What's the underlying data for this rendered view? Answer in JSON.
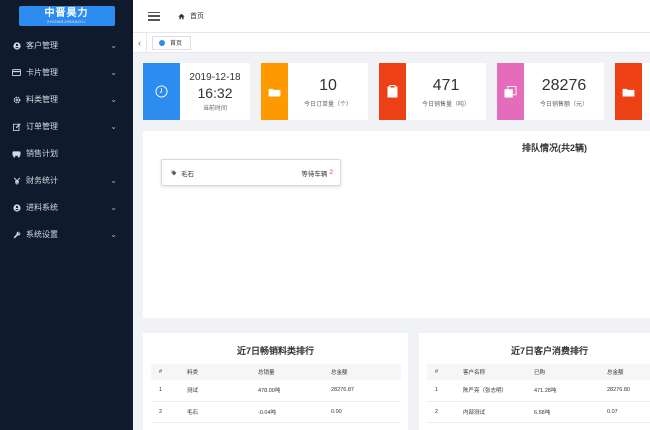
{
  "brand": {
    "name": "中晋昊力",
    "sub": "ZHONGJINHAOLI"
  },
  "sidebar": {
    "items": [
      {
        "label": "客户管理",
        "icon": "user-icon"
      },
      {
        "label": "卡片管理",
        "icon": "card-icon"
      },
      {
        "label": "料类管理",
        "icon": "gear-icon"
      },
      {
        "label": "订单管理",
        "icon": "edit-icon"
      },
      {
        "label": "销售计划",
        "icon": "truck-icon"
      },
      {
        "label": "财务统计",
        "icon": "yen-icon"
      },
      {
        "label": "进料系统",
        "icon": "user-icon"
      },
      {
        "label": "系统设置",
        "icon": "wrench-icon"
      }
    ]
  },
  "header": {
    "breadcrumb": "首页"
  },
  "tabs": [
    {
      "label": "首页"
    }
  ],
  "stats": {
    "date": {
      "date": "2019-12-18",
      "time": "16:32",
      "label": "当前时间",
      "color": "#2d8cf0"
    },
    "cards": [
      {
        "value": "10",
        "label": "今日订单量（个）",
        "color": "#ff9900"
      },
      {
        "value": "471",
        "label": "今日销售量（吨）",
        "color": "#ed4014"
      },
      {
        "value": "28276",
        "label": "今日销售额（元）",
        "color": "#e46cbb"
      },
      {
        "color": "#ed4014"
      }
    ]
  },
  "queue": {
    "title": "排队情况(共2辆)",
    "items": [
      {
        "name": "毛石",
        "status": "等待车辆",
        "count": "2"
      }
    ]
  },
  "sales_rank": {
    "title": "近7日畅销料类排行",
    "columns": [
      "#",
      "料类",
      "总销量",
      "总金额"
    ],
    "rows": [
      [
        "1",
        "测试",
        "478.00吨",
        "28276.87"
      ],
      [
        "2",
        "毛石",
        "-0.04吨",
        "0.00"
      ]
    ]
  },
  "customer_rank": {
    "title": "近7日客户消费排行",
    "columns": [
      "#",
      "客户名称",
      "已购",
      "总金额"
    ],
    "rows": [
      [
        "1",
        "陈严亮（张志明）",
        "471.28吨",
        "28276.80"
      ],
      [
        "2",
        "内部测试",
        "6.68吨",
        "0.07"
      ]
    ]
  }
}
